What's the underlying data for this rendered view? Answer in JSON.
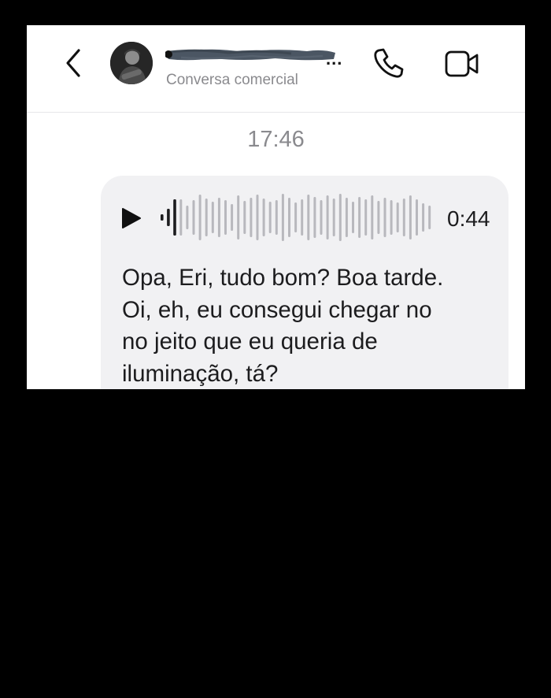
{
  "header": {
    "back_icon": "chevron-left-icon",
    "contact_name_suffix": "...",
    "subtitle": "Conversa comercial",
    "call_icon": "phone-icon",
    "video_icon": "video-camera-icon"
  },
  "chat": {
    "timestamp": "17:46",
    "voice_message": {
      "play_icon": "play-icon",
      "duration": "0:44",
      "transcript_lines": [
        "Opa, Eri, tudo bom? Boa tarde.",
        "Oi, eh, eu consegui chegar no",
        "no jeito que eu queria de",
        "iluminação, tá?"
      ]
    }
  },
  "colors": {
    "bubble_background": "#f1f1f3",
    "waveform_played": "#1c1c1e",
    "waveform_unplayed": "#b8b8bd",
    "secondary_text": "#8a8a8e"
  }
}
